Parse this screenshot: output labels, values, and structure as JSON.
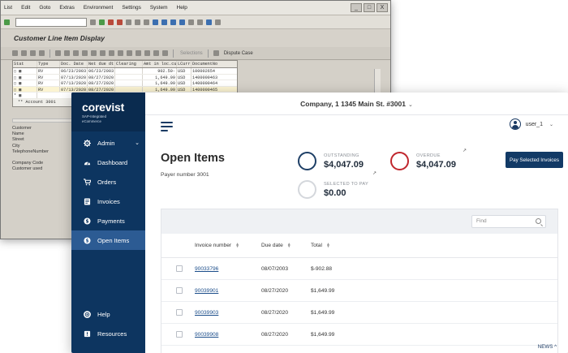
{
  "sap": {
    "menu": [
      "List",
      "Edit",
      "Goto",
      "Extras",
      "Environment",
      "Settings",
      "System",
      "Help"
    ],
    "window_controls": [
      "_",
      "□",
      "X"
    ],
    "title": "Customer Line Item Display",
    "toolbar_labels": {
      "selections": "Selections",
      "dispute": "Dispute Case"
    },
    "columns": [
      "Stat",
      "Type",
      "Doc. Date",
      "Net due dt",
      "Clearing",
      "Amt in loc.cur.",
      "LCurr",
      "DocumentNo"
    ],
    "rows": [
      [
        "",
        "RV",
        "06/23/2003",
        "06/23/2003",
        "",
        "902.50-",
        "USD",
        "100002654"
      ],
      [
        "",
        "RV",
        "07/13/2020",
        "08/27/2020",
        "",
        "1,649.99",
        "USD",
        "1400000463"
      ],
      [
        "",
        "RV",
        "07/13/2020",
        "08/27/2020",
        "",
        "1,649.99",
        "USD",
        "1400000464"
      ],
      [
        "",
        "RV",
        "07/13/2020",
        "08/27/2020",
        "",
        "1,649.99",
        "USD",
        "1400000465"
      ]
    ],
    "account_line": "** Account 3001",
    "labels": [
      "Customer",
      "Name",
      "Street",
      "City",
      "TelephoneNumber"
    ],
    "labels2": [
      "Company Code",
      "Customer used"
    ]
  },
  "app": {
    "brand": {
      "name": "corevist",
      "sub1": "SAP-Integrated",
      "sub2": "eCommerce"
    },
    "company": "Company, 1 1345 Main St. #3001",
    "user": "user_1",
    "nav": [
      {
        "label": "Admin",
        "icon": "gear-icon"
      },
      {
        "label": "Dashboard",
        "icon": "dashboard-icon"
      },
      {
        "label": "Orders",
        "icon": "orders-icon"
      },
      {
        "label": "Invoices",
        "icon": "invoices-icon"
      },
      {
        "label": "Payments",
        "icon": "payments-icon"
      },
      {
        "label": "Open Items",
        "icon": "dollar-icon"
      }
    ],
    "nav_bottom": [
      {
        "label": "Help",
        "icon": "help-icon"
      },
      {
        "label": "Resources",
        "icon": "resources-icon"
      }
    ],
    "page_title": "Open Items",
    "payer_label": "Payer number",
    "payer_number": "3001",
    "outstanding": {
      "label": "OUTSTANDING",
      "value": "$4,047.09",
      "color": "#1e3f66"
    },
    "overdue": {
      "label": "OVERDUE",
      "value": "$4,047.09",
      "color": "#c0262d"
    },
    "selected": {
      "label": "SELECTED TO PAY",
      "value": "$0.00",
      "color": "#d4d7dc"
    },
    "pay_button": "Pay Selected Invoices",
    "find_placeholder": "Find",
    "table": {
      "headers": {
        "invoice": "Invoice number",
        "due": "Due date",
        "total": "Total"
      },
      "rows": [
        {
          "invoice": "90033796",
          "due": "08/07/2003",
          "total": "$-902.88"
        },
        {
          "invoice": "90039901",
          "due": "08/27/2020",
          "total": "$1,649.99"
        },
        {
          "invoice": "90039903",
          "due": "08/27/2020",
          "total": "$1,649.99"
        },
        {
          "invoice": "90039908",
          "due": "08/27/2020",
          "total": "$1,649.99"
        }
      ]
    },
    "news": "NEWS"
  }
}
